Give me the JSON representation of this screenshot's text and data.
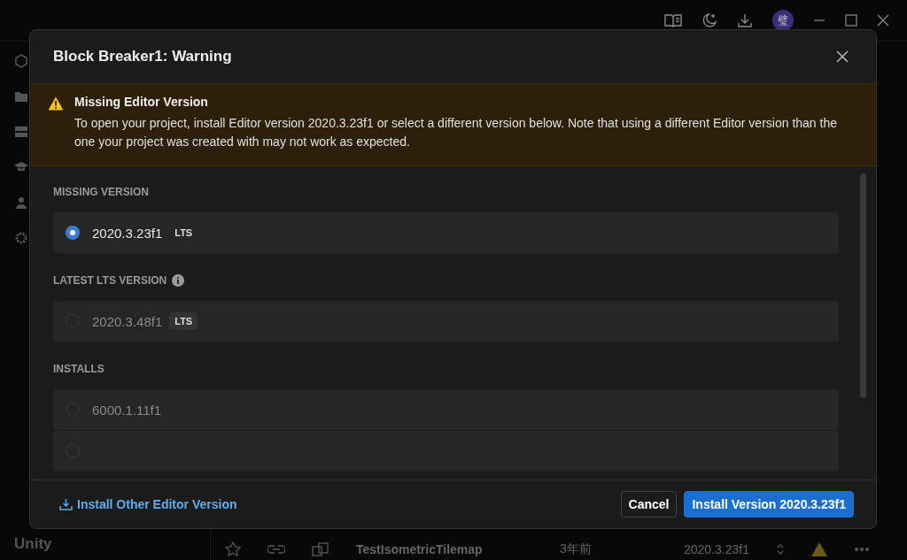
{
  "app": {
    "avatar": "璧",
    "brand": "Unity",
    "project_row": {
      "name": "TestIsometricTilemap",
      "modified": "3年前",
      "version": "2020.3.23f1"
    }
  },
  "dialog": {
    "title": "Block Breaker1: Warning",
    "alert": {
      "title": "Missing Editor Version",
      "message": "To open your project, install Editor version 2020.3.23f1 or select a different version below. Note that using a different Editor version than the one your project was created with may not work as expected."
    },
    "sections": [
      {
        "heading": "MISSING VERSION",
        "info": false,
        "options": [
          {
            "version": "2020.3.23f1",
            "badge": "LTS",
            "selected": true
          }
        ]
      },
      {
        "heading": "LATEST LTS VERSION",
        "info": true,
        "options": [
          {
            "version": "2020.3.48f1",
            "badge": "LTS",
            "selected": false
          }
        ]
      },
      {
        "heading": "INSTALLS",
        "info": false,
        "options": [
          {
            "version": "6000.1.11f1",
            "selected": false
          },
          {
            "selected": false
          }
        ]
      }
    ],
    "footer": {
      "link": "Install Other Editor Version",
      "buttons": [
        {
          "label": "Cancel",
          "kind": "secondary"
        },
        {
          "label": "Install Version 2020.3.23f1",
          "kind": "primary"
        }
      ]
    }
  }
}
